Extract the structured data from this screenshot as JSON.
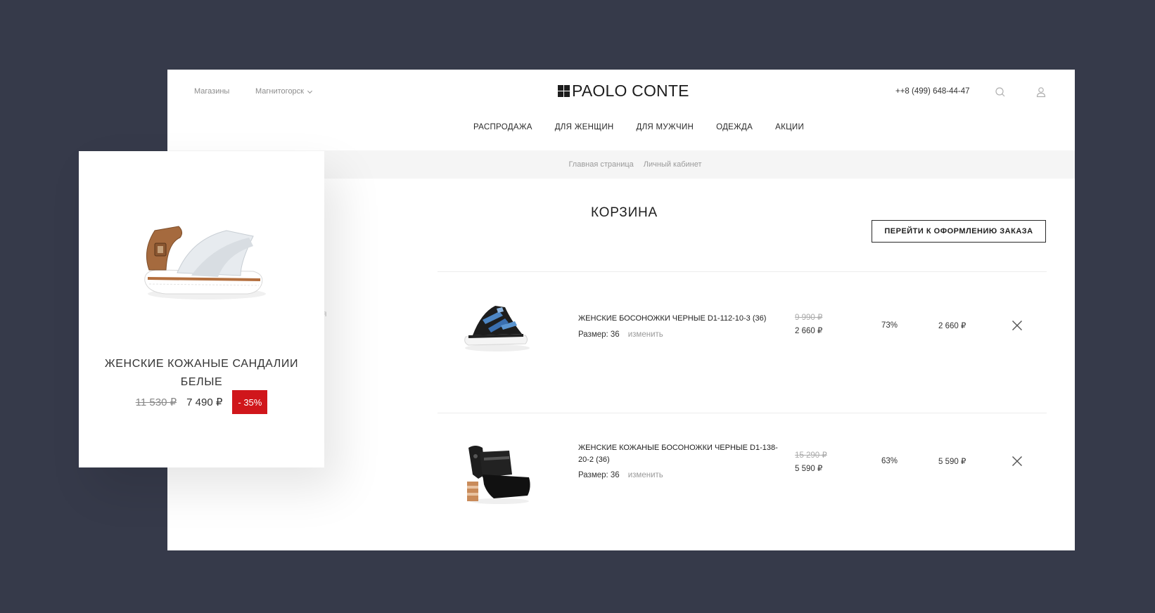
{
  "header": {
    "stores_label": "Магазины",
    "city_label": "Магнитогорск",
    "logo_text": "PAOLO CONTE",
    "phone": "++8 (499) 648-44-47"
  },
  "nav": {
    "items": [
      {
        "label": "РАСПРОДАЖА"
      },
      {
        "label": "ДЛЯ ЖЕНЩИН"
      },
      {
        "label": "ДЛЯ МУЖЧИН"
      },
      {
        "label": "ОДЕЖДА"
      },
      {
        "label": "АКЦИИ"
      }
    ]
  },
  "breadcrumbs": {
    "home": "Главная страница",
    "current": "Личный кабинет"
  },
  "cart": {
    "title": "КОРЗИНА",
    "checkout_label": "ПЕРЕЙТИ К ОФОРМЛЕНИЮ ЗАКАЗА",
    "change_label": "изменить",
    "items": [
      {
        "name": "ЖЕНСКИЕ БОСОНОЖКИ ЧЕРНЫЕ D1-112-10-3 (36)",
        "size": "Размер: 36",
        "old_price": "9 990 ₽",
        "price": "2 660 ₽",
        "discount": "73%",
        "total": "2 660 ₽"
      },
      {
        "name": "ЖЕНСКИЕ КОЖАНЫЕ БОСОНОЖКИ ЧЕРНЫЕ D1-138-20-2 (36)",
        "size": "Размер: 36",
        "old_price": "15 290 ₽",
        "price": "5 590 ₽",
        "discount": "63%",
        "total": "5 590 ₽"
      }
    ]
  },
  "side_text": "я",
  "product_card": {
    "title": "ЖЕНСКИЕ КОЖАНЫЕ САНДАЛИИ БЕЛЫЕ",
    "old_price": "11 530 ₽",
    "price": "7 490 ₽",
    "badge": "- 35%",
    "badge_color": "#d0161b"
  },
  "colors": {
    "background": "#363a4a",
    "text": "#1f1f1f",
    "muted": "#9a9a9a"
  }
}
